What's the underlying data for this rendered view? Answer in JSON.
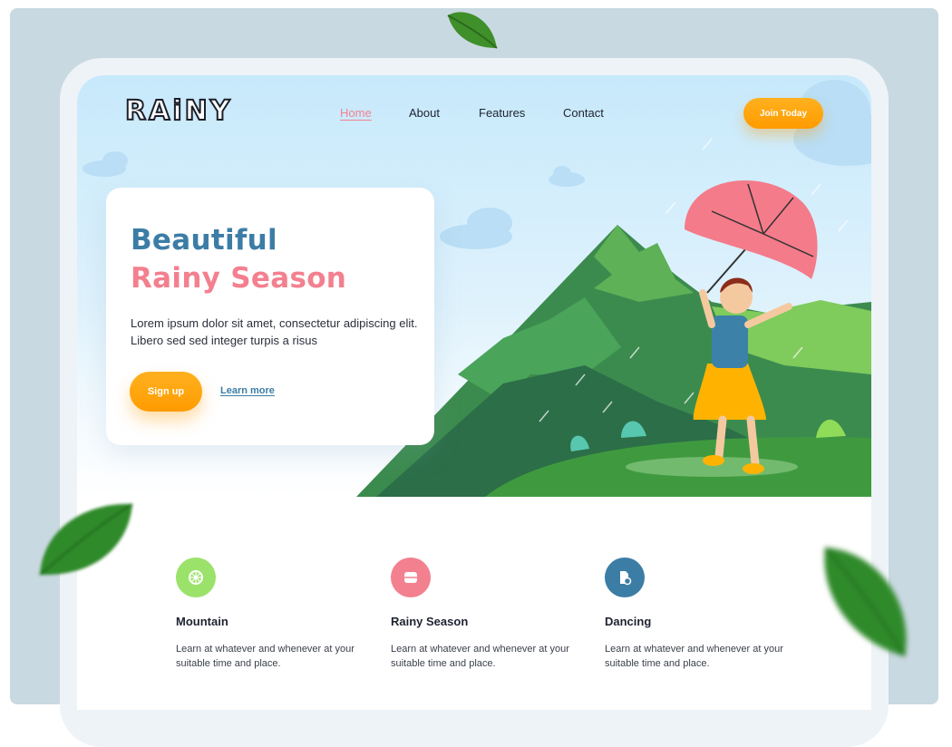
{
  "brand": {
    "logo": "RAiNY"
  },
  "nav": {
    "items": [
      {
        "label": "Home",
        "active": true
      },
      {
        "label": "About",
        "active": false
      },
      {
        "label": "Features",
        "active": false
      },
      {
        "label": "Contact",
        "active": false
      }
    ],
    "cta_label": "Join Today"
  },
  "hero": {
    "title_line1": "Beautiful",
    "title_line2": "Rainy Season",
    "description": "Lorem ipsum dolor sit amet, consectetur adipiscing elit. Libero sed sed integer turpis a risus",
    "signup_label": "Sign up",
    "learn_more_label": "Learn more"
  },
  "features": [
    {
      "title": "Mountain",
      "description": "Learn at whatever and whenever at your suitable time and place.",
      "icon": "mountain-icon",
      "color": "#9be26a"
    },
    {
      "title": "Rainy Season",
      "description": "Learn at whatever and whenever at your suitable time and place.",
      "icon": "rain-icon",
      "color": "#f3808f"
    },
    {
      "title": "Dancing",
      "description": "Learn at whatever and whenever at your suitable time and place.",
      "icon": "dancing-icon",
      "color": "#3c7da6"
    }
  ],
  "colors": {
    "accent_orange": "#ff9b00",
    "pink": "#f3808f",
    "blue": "#3c7da6",
    "green": "#9be26a",
    "backdrop": "#c9d9e1"
  }
}
